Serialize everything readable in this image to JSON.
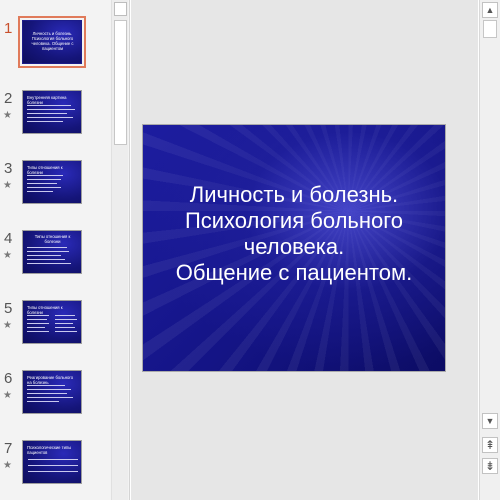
{
  "thumbnails": [
    {
      "number": "1",
      "title": "Личность и болезнь. Психология больного человека. Общение с пациентом",
      "active": true
    },
    {
      "number": "2",
      "title": "Внутренняя картина болезни"
    },
    {
      "number": "3",
      "title": "Типы отношения к болезни"
    },
    {
      "number": "4",
      "title": "Типы отношения к болезни"
    },
    {
      "number": "5",
      "title": "Типы отношения к болезни"
    },
    {
      "number": "6",
      "title": "Реагирование больного на болезнь"
    },
    {
      "number": "7",
      "title": "Психологические типы пациентов"
    }
  ],
  "star_glyph": "★",
  "slide": {
    "title_lines": [
      "Личность и болезнь.",
      "Психология больного",
      "человека.",
      "Общение с пациентом."
    ]
  },
  "scroll": {
    "up_glyph": "▲",
    "down_glyph": "▼",
    "prev_slide_glyph": "⇞",
    "next_slide_glyph": "⇟"
  },
  "colors": {
    "slide_background": "#1a1a8e",
    "selection_outline": "#e07a5a",
    "active_number": "#c8502d"
  }
}
